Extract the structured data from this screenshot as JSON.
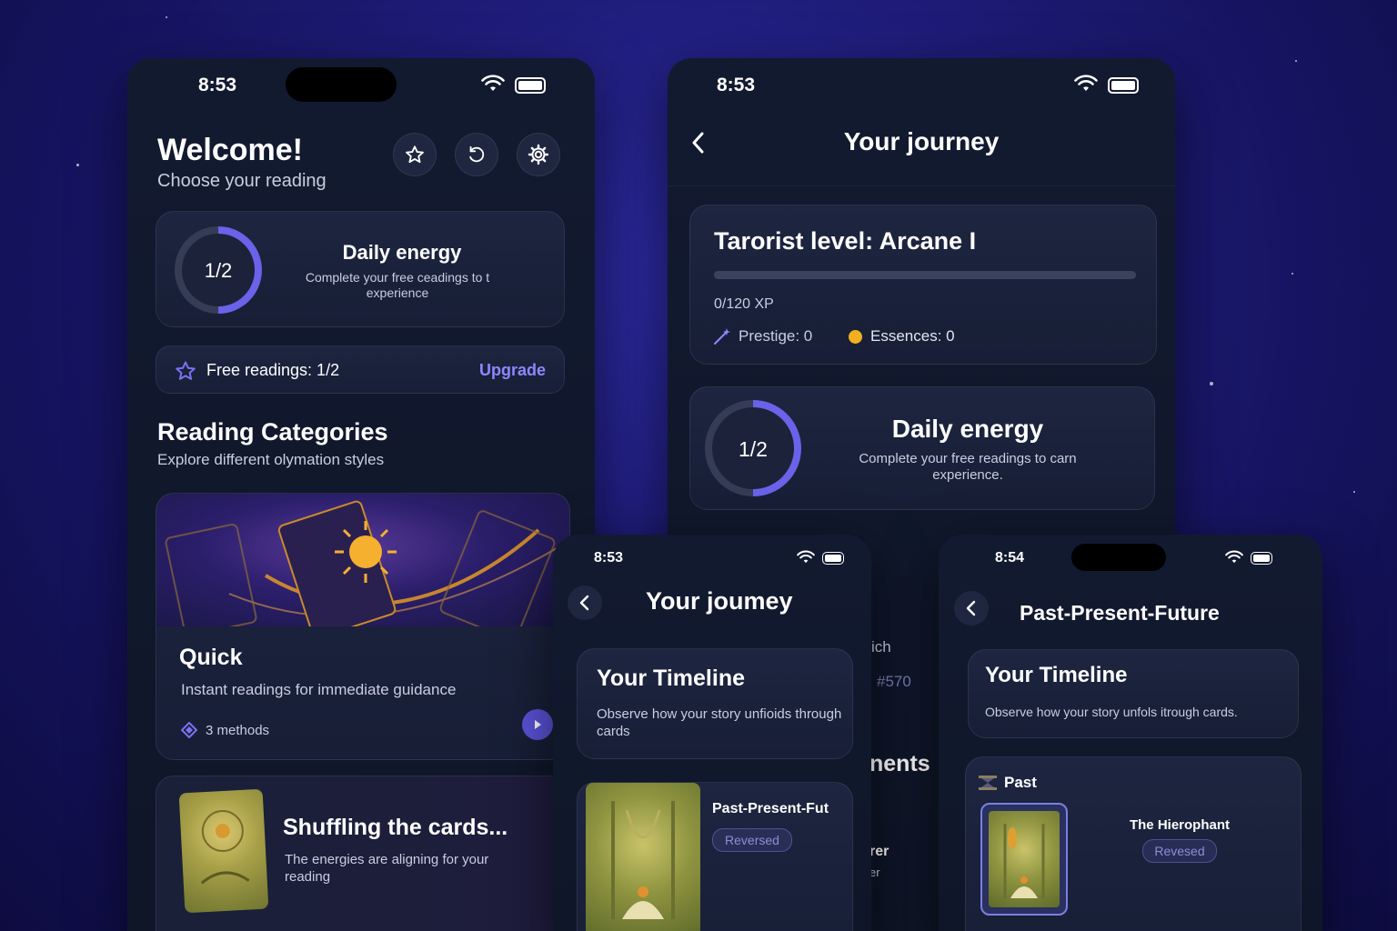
{
  "status": {
    "time_a": "8:53",
    "time_b": "8:53",
    "time_c": "8:53",
    "time_d": "8:54"
  },
  "home": {
    "title": "Welcome!",
    "subtitle": "Choose your reading",
    "icons": [
      "star-icon",
      "history-icon",
      "gear-icon"
    ],
    "energy": {
      "counter": "1/2",
      "title": "Daily energy",
      "desc": "Complete your free ceadings to t experience",
      "progress": 0.5
    },
    "free": {
      "label": "Free readings: 1/2",
      "upgrade": "Upgrade"
    },
    "categories": {
      "title": "Reading Categories",
      "subtitle": "Explore different olymation styles"
    },
    "quick": {
      "title": "Quick",
      "desc": "Instant readings for immediate guidance",
      "methods": "3 methods"
    },
    "shuffle": {
      "title": "Shuffling the cards...",
      "desc": "The energies are aligning for your reading"
    }
  },
  "journey": {
    "title": "Your journey",
    "level": {
      "title": "Tarorist level: Arcane I",
      "xp": "0/120 XP",
      "xp_fraction": 0,
      "prestige": "Prestige: 0",
      "essences": "Essences: 0"
    },
    "energy": {
      "counter": "1/2",
      "title": "Daily energy",
      "desc": "Complete your free readings to carn experience.",
      "progress": 0.5
    },
    "peek": {
      "a": "ich",
      "b": "#570",
      "c": "nents",
      "d": "rer",
      "e": "er"
    }
  },
  "journey_small": {
    "title": "Your joumey",
    "timeline_title": "Your Timeline",
    "timeline_desc": "Observe how your story unfioids through cards",
    "spread": "Past-Present-Fut",
    "badge": "Reversed"
  },
  "ppf": {
    "title": "Past-Present-Future",
    "timeline_title": "Your Timeline",
    "timeline_desc": "Observe how your story unfols itrough cards.",
    "past": "Past",
    "card_name": "The Hierophant",
    "badge": "Revesed"
  },
  "colors": {
    "accent": "#6a62e8",
    "gold": "#f0b020"
  }
}
